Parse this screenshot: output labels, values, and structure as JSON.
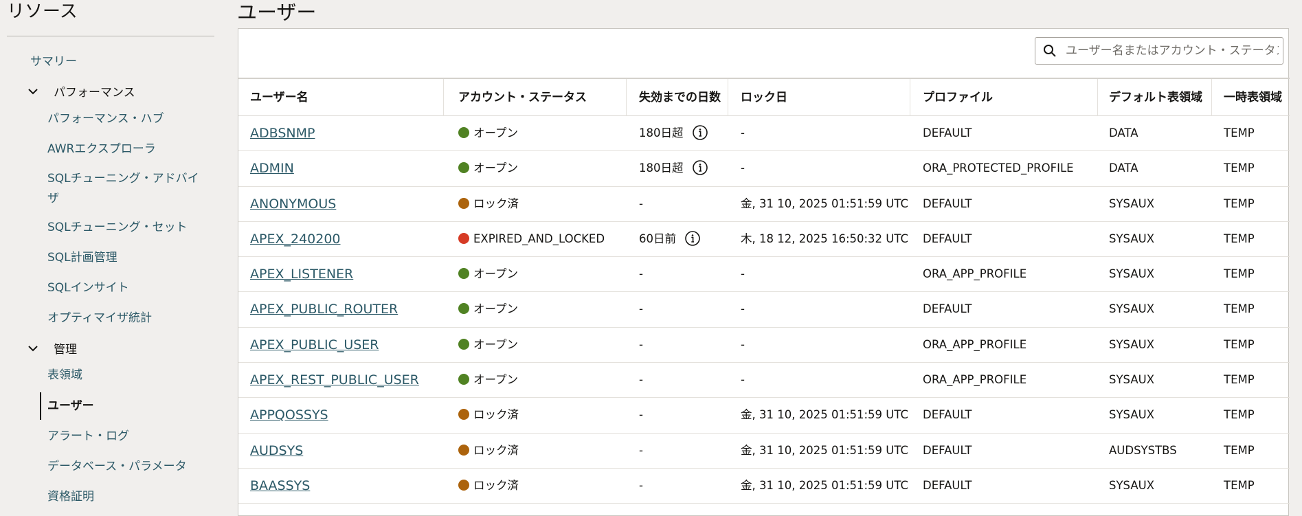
{
  "sidebar": {
    "title": "リソース",
    "items": [
      {
        "label": "サマリー"
      },
      {
        "label": "パフォーマンス"
      },
      {
        "label": "パフォーマンス・ハブ"
      },
      {
        "label": "AWRエクスプローラ"
      },
      {
        "label": "SQLチューニング・アドバイザ"
      },
      {
        "label": "SQLチューニング・セット"
      },
      {
        "label": "SQL計画管理"
      },
      {
        "label": "SQLインサイト"
      },
      {
        "label": "オプティマイザ統計"
      },
      {
        "label": "管理"
      },
      {
        "label": "表領域"
      },
      {
        "label": "ユーザー"
      },
      {
        "label": "アラート・ログ"
      },
      {
        "label": "データベース・パラメータ"
      },
      {
        "label": "資格証明"
      }
    ]
  },
  "page": {
    "title": "ユーザー"
  },
  "search": {
    "placeholder": "ユーザー名またはアカウント・ステータス"
  },
  "table": {
    "columns": [
      "ユーザー名",
      "アカウント・ステータス",
      "失効までの日数",
      "ロック日",
      "プロファイル",
      "デフォルト表領域",
      "一時表領域"
    ],
    "rows": [
      {
        "user": "ADBSNMP",
        "status": "オープン",
        "status_color": "#508223",
        "expiry": "180日超",
        "info": true,
        "lock": "-",
        "profile": "DEFAULT",
        "default_ts": "DATA",
        "temp_ts": "TEMP"
      },
      {
        "user": "ADMIN",
        "status": "オープン",
        "status_color": "#508223",
        "expiry": "180日超",
        "info": true,
        "lock": "-",
        "profile": "ORA_PROTECTED_PROFILE",
        "default_ts": "DATA",
        "temp_ts": "TEMP"
      },
      {
        "user": "ANONYMOUS",
        "status": "ロック済",
        "status_color": "#ac630c",
        "expiry": "-",
        "info": false,
        "lock": "金, 31 10, 2025 01:51:59 UTC",
        "profile": "DEFAULT",
        "default_ts": "SYSAUX",
        "temp_ts": "TEMP"
      },
      {
        "user": "APEX_240200",
        "status": "EXPIRED_AND_LOCKED",
        "status_color": "#d63b25",
        "expiry": "60日前",
        "info": true,
        "lock": "木, 18 12, 2025 16:50:32 UTC",
        "profile": "DEFAULT",
        "default_ts": "SYSAUX",
        "temp_ts": "TEMP"
      },
      {
        "user": "APEX_LISTENER",
        "status": "オープン",
        "status_color": "#508223",
        "expiry": "-",
        "info": false,
        "lock": "-",
        "profile": "ORA_APP_PROFILE",
        "default_ts": "SYSAUX",
        "temp_ts": "TEMP"
      },
      {
        "user": "APEX_PUBLIC_ROUTER",
        "status": "オープン",
        "status_color": "#508223",
        "expiry": "-",
        "info": false,
        "lock": "-",
        "profile": "DEFAULT",
        "default_ts": "SYSAUX",
        "temp_ts": "TEMP"
      },
      {
        "user": "APEX_PUBLIC_USER",
        "status": "オープン",
        "status_color": "#508223",
        "expiry": "-",
        "info": false,
        "lock": "-",
        "profile": "ORA_APP_PROFILE",
        "default_ts": "SYSAUX",
        "temp_ts": "TEMP"
      },
      {
        "user": "APEX_REST_PUBLIC_USER",
        "status": "オープン",
        "status_color": "#508223",
        "expiry": "-",
        "info": false,
        "lock": "-",
        "profile": "ORA_APP_PROFILE",
        "default_ts": "SYSAUX",
        "temp_ts": "TEMP"
      },
      {
        "user": "APPQOSSYS",
        "status": "ロック済",
        "status_color": "#ac630c",
        "expiry": "-",
        "info": false,
        "lock": "金, 31 10, 2025 01:51:59 UTC",
        "profile": "DEFAULT",
        "default_ts": "SYSAUX",
        "temp_ts": "TEMP"
      },
      {
        "user": "AUDSYS",
        "status": "ロック済",
        "status_color": "#ac630c",
        "expiry": "-",
        "info": false,
        "lock": "金, 31 10, 2025 01:51:59 UTC",
        "profile": "DEFAULT",
        "default_ts": "AUDSYSTBS",
        "temp_ts": "TEMP"
      },
      {
        "user": "BAASSYS",
        "status": "ロック済",
        "status_color": "#ac630c",
        "expiry": "-",
        "info": false,
        "lock": "金, 31 10, 2025 01:51:59 UTC",
        "profile": "DEFAULT",
        "default_ts": "SYSAUX",
        "temp_ts": "TEMP"
      }
    ]
  },
  "icons": {
    "search": "search-icon",
    "info": "info-icon",
    "chevron": "chevron-down-icon"
  }
}
